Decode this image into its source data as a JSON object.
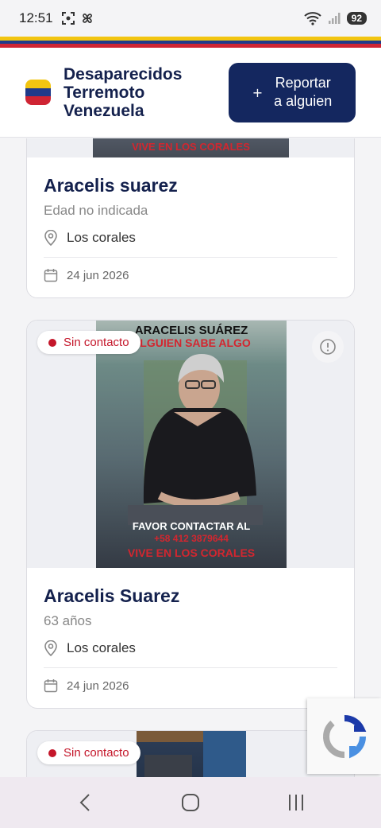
{
  "status_bar": {
    "time": "12:51",
    "battery": "92",
    "icons": [
      "screenshot-icon",
      "pinwheel-icon",
      "wifi-icon",
      "signal-icon",
      "battery-icon"
    ]
  },
  "header": {
    "title": "Desaparecidos\nTerremoto\nVenezuela",
    "report_button": "Reportar\na alguien",
    "report_icon": "+"
  },
  "colors": {
    "yellow": "#f2c511",
    "blue": "#1f3a8a",
    "red": "#cf2433",
    "navy": "#14275f",
    "badge_red": "#c4162a"
  },
  "cards": [
    {
      "poster_text": [
        "VIVE EN LOS CORALES"
      ],
      "name": "Aracelis suarez",
      "age": "Edad no indicada",
      "location": "Los corales",
      "date": "24 jun 2026"
    },
    {
      "badge": "Sin contacto",
      "poster_title": "ARACELIS SUÁREZ",
      "poster_sub": "ALGUIEN SABE ALGO",
      "poster_contact": "FAVOR CONTACTAR AL",
      "poster_phone": "+58 412 3879644",
      "poster_lives": "VIVE EN LOS CORALES",
      "name": "Aracelis Suarez",
      "age": "63 años",
      "location": "Los corales",
      "date": "24 jun 2026"
    },
    {
      "badge": "Sin contacto"
    }
  ],
  "nav": {
    "back": "back-icon",
    "home": "home-icon",
    "recents": "recents-icon"
  }
}
